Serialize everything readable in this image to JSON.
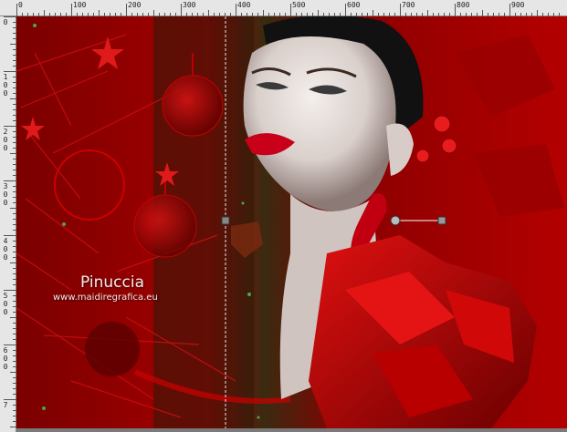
{
  "ruler": {
    "top_labels": [
      "0",
      "100",
      "200",
      "300",
      "400",
      "500",
      "600",
      "700",
      "800",
      "900"
    ],
    "left_labels": [
      [
        "0"
      ],
      [
        "1",
        "0",
        "0"
      ],
      [
        "2",
        "0",
        "0"
      ],
      [
        "3",
        "0",
        "0"
      ],
      [
        "4",
        "0",
        "0"
      ],
      [
        "5",
        "0",
        "0"
      ],
      [
        "6",
        "0",
        "0"
      ],
      [
        "7"
      ]
    ]
  },
  "watermark": {
    "name": "Pinuccia",
    "url": "www.maidiregrafica.eu"
  },
  "colors": {
    "background_red": "#a80000",
    "dark_green": "#1f2a12",
    "lips": "#c8001a",
    "ruler_bg": "#e6e6e6"
  },
  "guides": {
    "guide_icon": "guide-line",
    "handle_icon": "rotation-handle-icon"
  }
}
